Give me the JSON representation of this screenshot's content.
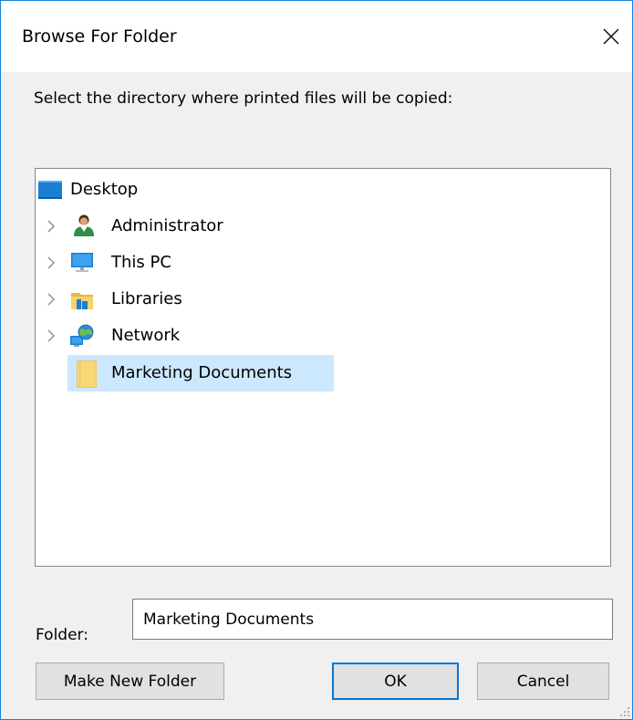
{
  "window": {
    "title": "Browse For Folder",
    "close_icon": "close-icon"
  },
  "prompt": "Select the directory where printed files will be copied:",
  "tree": {
    "items": [
      {
        "label": "Desktop",
        "icon": "desktop-icon",
        "expandable": false,
        "selected": false
      },
      {
        "label": "Administrator",
        "icon": "user-icon",
        "expandable": true,
        "selected": false
      },
      {
        "label": "This PC",
        "icon": "computer-icon",
        "expandable": true,
        "selected": false
      },
      {
        "label": "Libraries",
        "icon": "libraries-icon",
        "expandable": true,
        "selected": false
      },
      {
        "label": "Network",
        "icon": "network-icon",
        "expandable": true,
        "selected": false
      },
      {
        "label": "Marketing Documents",
        "icon": "folder-icon",
        "expandable": false,
        "selected": true
      }
    ]
  },
  "folder": {
    "label": "Folder:",
    "value": "Marketing Documents"
  },
  "buttons": {
    "make_new_folder": "Make New Folder",
    "ok": "OK",
    "cancel": "Cancel"
  },
  "colors": {
    "accent": "#0078d7",
    "selection": "#cce8ff",
    "window_border": "#1883d7"
  }
}
